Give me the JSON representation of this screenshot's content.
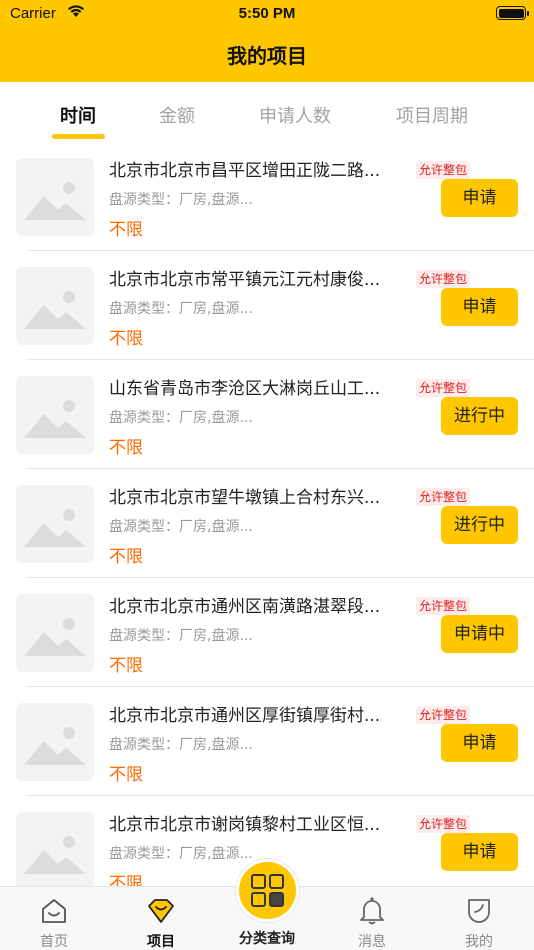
{
  "status_bar": {
    "carrier": "Carrier",
    "time": "5:50 PM"
  },
  "header": {
    "title": "我的项目"
  },
  "tabs": [
    {
      "label": "时间",
      "active": true
    },
    {
      "label": "金额",
      "active": false
    },
    {
      "label": "申请人数",
      "active": false
    },
    {
      "label": "项目周期",
      "active": false
    }
  ],
  "items": [
    {
      "title": "北京市北京市昌平区增田正陇二路...",
      "badge": "允许整包",
      "type": "盘源类型：厂房,盘源...",
      "price": "不限",
      "action": "申请"
    },
    {
      "title": "北京市北京市常平镇元江元村康俊...",
      "badge": "允许整包",
      "type": "盘源类型：厂房,盘源...",
      "price": "不限",
      "action": "申请"
    },
    {
      "title": "山东省青岛市李沧区大淋岗丘山工...",
      "badge": "允许整包",
      "type": "盘源类型：厂房,盘源...",
      "price": "不限",
      "action": "进行中"
    },
    {
      "title": "北京市北京市望牛墩镇上合村东兴...",
      "badge": "允许整包",
      "type": "盘源类型：厂房,盘源...",
      "price": "不限",
      "action": "进行中"
    },
    {
      "title": "北京市北京市通州区南潢路湛翠段...",
      "badge": "允许整包",
      "type": "盘源类型：厂房,盘源...",
      "price": "不限",
      "action": "申请中"
    },
    {
      "title": "北京市北京市通州区厚街镇厚街村...",
      "badge": "允许整包",
      "type": "盘源类型：厂房,盘源...",
      "price": "不限",
      "action": "申请"
    },
    {
      "title": "北京市北京市谢岗镇黎村工业区恒...",
      "badge": "允许整包",
      "type": "盘源类型：厂房,盘源...",
      "price": "不限",
      "action": "申请"
    }
  ],
  "tabbar": {
    "home": "首页",
    "projects": "项目",
    "category": "分类查询",
    "messages": "消息",
    "mine": "我的"
  },
  "colors": {
    "brand": "#FFC700",
    "price": "#FF6A00",
    "badge_text": "#E02020",
    "badge_bg": "#FDECEC"
  },
  "icons": [
    "wifi-icon",
    "battery-icon",
    "image-placeholder-icon",
    "home-icon",
    "projects-icon",
    "category-grid-icon",
    "bell-icon",
    "mine-icon"
  ]
}
